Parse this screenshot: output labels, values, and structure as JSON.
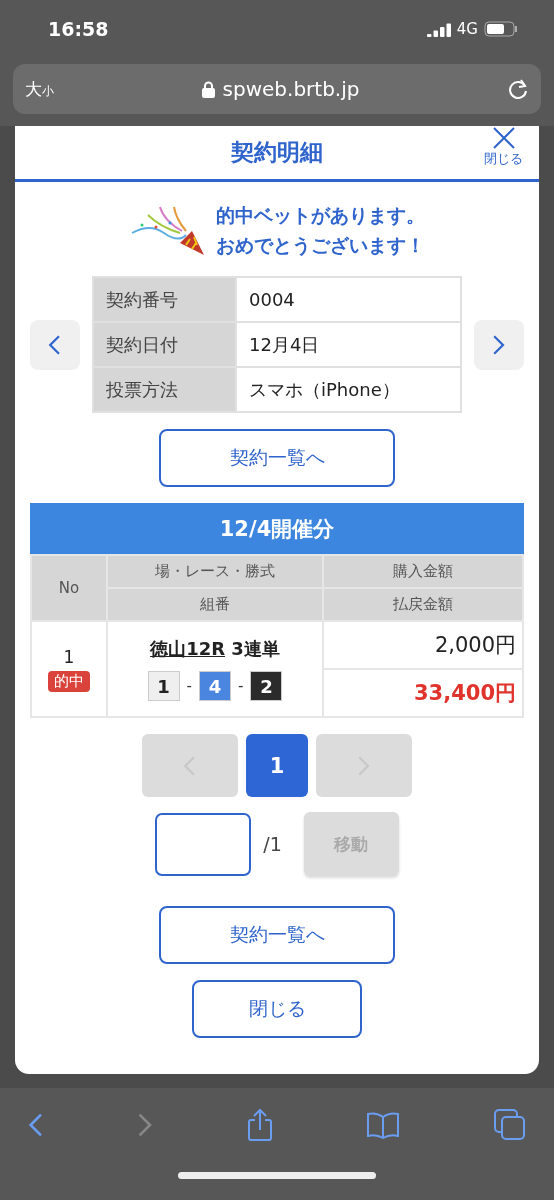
{
  "status_bar": {
    "time": "16:58",
    "network": "4G"
  },
  "browser": {
    "text_size": [
      "大",
      "小"
    ],
    "url": "spweb.brtb.jp",
    "back_disabled": false,
    "forward_disabled": true
  },
  "modal": {
    "title": "契約明細",
    "close_label": "閉じる",
    "message": [
      "的中ベットがあります。",
      "おめでとうございます！"
    ],
    "info": [
      {
        "label": "契約番号",
        "value": "0004"
      },
      {
        "label": "契約日付",
        "value": "12月4日"
      },
      {
        "label": "投票方法",
        "value": "スマホ（iPhone）"
      }
    ],
    "list_button": "契約一覧へ",
    "section_title": "12/4開催分",
    "columns": {
      "no": "No",
      "race": "場・レース・勝式",
      "combo": "組番",
      "purchase": "購入金額",
      "payout": "払戻金額"
    },
    "rows": [
      {
        "no": "1",
        "hit": true,
        "badge": "的中",
        "race": "徳山12R",
        "bet_type": "3連単",
        "combination": [
          {
            "number": "1",
            "color": "#efefef"
          },
          {
            "number": "4",
            "color": "#4a86e0"
          },
          {
            "number": "2",
            "color": "#2b2b2b"
          }
        ],
        "separator": "-",
        "purchase": "2,000円",
        "payout": "33,400円"
      }
    ],
    "pagination": [
      {
        "kind": "prev",
        "disabled": true,
        "selected": false
      },
      {
        "kind": "page",
        "label": "1",
        "selected": true,
        "disabled": false
      },
      {
        "kind": "next",
        "disabled": true,
        "selected": false
      }
    ],
    "jump": {
      "total": "/1",
      "button": "移動",
      "disabled": true
    },
    "bottom_buttons": [
      "契約一覧へ",
      "閉じる"
    ]
  }
}
